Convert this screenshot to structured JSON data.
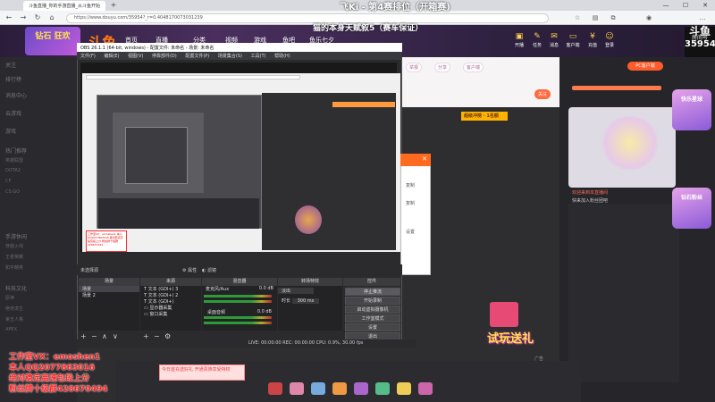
{
  "browser": {
    "tab_title": "斗鱼直播_你的手游直播_从斗鱼开始",
    "new_tab": "+",
    "address": "https://www.douyu.com/35954?_r=0.4048170073031239",
    "win_min": "—",
    "win_max": "☐",
    "win_close": "✕"
  },
  "overlay": {
    "title": "飞Ki - 第4赛排位（开箱赛)",
    "subtitle": "猫的本身天赋叙5（赛车保证）"
  },
  "douyu": {
    "logo": "斗鱼",
    "promo": "钻石 狂欢",
    "nav": [
      "首页",
      "直播",
      "分类",
      "视频",
      "游戏",
      "鱼吧",
      "鱼乐七夕"
    ],
    "header_icons": [
      "开播",
      "任务",
      "消息",
      "客户端",
      "充值",
      "登录"
    ],
    "watermark_logo": "斗鱼",
    "watermark_line1": "房间号",
    "watermark_room": "35954"
  },
  "sidebar": {
    "items": [
      "关注",
      "排行榜",
      "消息中心",
      "云游戏",
      "游戏",
      "热门推荐",
      "网游竞技",
      "单机热游",
      "手游休闲",
      "娱乐天地",
      "科技文化",
      "正能量",
      "语音互动"
    ],
    "grid": [
      "英雄联盟",
      "DOTA2",
      "CF",
      "CS:GO",
      "穿越火线",
      "王者荣耀",
      "和平精英",
      "原神",
      "绝地求生",
      "第五人格",
      "APEX",
      "永劫无间"
    ]
  },
  "stream": {
    "pills": [
      "举报",
      "分享",
      "客户端",
      "关注"
    ],
    "promo_bar": "超级冲榜 · 1名额"
  },
  "right": {
    "pc_badge": "PC客户端",
    "messages": [
      "欢迎来到本直播间",
      "快来加入粉丝团吧"
    ],
    "side_ad_1": "快乐星球",
    "side_ad_2": "钻石粉丝"
  },
  "obs": {
    "title": "OBS 26.1.1 (64-bit, windows) - 配置文件: 未命名 - 场景: 未命名",
    "menu": [
      "文件(F)",
      "编辑(E)",
      "视图(V)",
      "停靠部件(D)",
      "配置文件(P)",
      "场景集合(S)",
      "工具(T)",
      "帮助(H)"
    ],
    "no_source": "未选择源",
    "properties": "属性",
    "filters": "滤镜",
    "dock_headers": [
      "场景",
      "来源",
      "混音器",
      "转场特效",
      "控件"
    ],
    "scenes": [
      "场景",
      "场景 2"
    ],
    "sources": [
      "文本 (GDI+) 3",
      "文本 (GDI+) 2",
      "文本 (GDI+)",
      "显示器采集",
      "窗口采集"
    ],
    "mixer": [
      {
        "name": "麦克风/Aux",
        "db": "0.0 dB"
      },
      {
        "name": "桌面音频",
        "db": "0.0 dB"
      }
    ],
    "transition": {
      "type": "淡出",
      "duration_label": "时长",
      "duration": "300 ms"
    },
    "controls": [
      "停止推流",
      "开始录制",
      "启动虚拟摄像机",
      "工作室模式",
      "设置",
      "退出"
    ],
    "statusbar": "LIVE: 00:00:00   REC: 00:00:00   CPU: 0.9%, 30.00 fps",
    "inner_card": "工作室VX：emoshen1 本人QQ2077863016 绝对稳定高速包段上分 粉丝牌十级群428670494"
  },
  "dialog": {
    "close": "✕",
    "items": [
      "复制",
      "复制",
      "设置"
    ]
  },
  "promo_overlay": [
    "工作室VX：emoshen1",
    "本人QQ2077863016",
    "绝对稳定高速包段上分",
    "粉丝牌十级群428670494"
  ],
  "bottom": {
    "gift_banner": "今日首充送好礼 开通贵族享受特权",
    "trial": "试玩送礼",
    "ad": "广告"
  }
}
